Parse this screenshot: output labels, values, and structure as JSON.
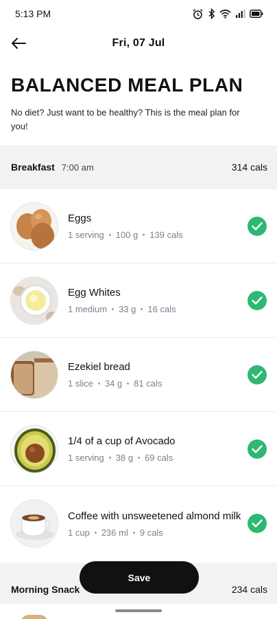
{
  "status_bar": {
    "time": "5:13 PM",
    "icons": [
      "alarm-icon",
      "bluetooth-icon",
      "wifi-icon",
      "signal-icon",
      "battery-icon"
    ]
  },
  "app_bar": {
    "back_icon": "arrow-left-icon",
    "title": "Fri, 07 Jul"
  },
  "plan": {
    "title": "BALANCED MEAL PLAN",
    "description": "No diet? Just want to be healthy?  This is the meal plan for you!"
  },
  "sections": [
    {
      "name": "Breakfast",
      "time": "7:00 am",
      "cals": "314 cals",
      "items": [
        {
          "name": "Eggs",
          "serving": "1 serving",
          "weight": "100 g",
          "cals": "139 cals",
          "done": true
        },
        {
          "name": "Egg Whites",
          "serving": "1 medium",
          "weight": "33 g",
          "cals": "16 cals",
          "done": true
        },
        {
          "name": "Ezekiel bread",
          "serving": "1 slice",
          "weight": "34 g",
          "cals": "81 cals",
          "done": true
        },
        {
          "name": "1/4 of a cup of Avocado",
          "serving": "1 serving",
          "weight": "38 g",
          "cals": "69 cals",
          "done": true
        },
        {
          "name": "Coffee with unsweetened almond milk",
          "serving": "1 cup",
          "weight": "236 ml",
          "cals": "9 cals",
          "done": true
        }
      ]
    },
    {
      "name": "Morning Snack",
      "time": "",
      "cals": "234 cals"
    }
  ],
  "save_button": {
    "label": "Save"
  },
  "colors": {
    "accent_green": "#2eb872",
    "section_bg": "#f1f2f4",
    "meta_gray": "#7a8090"
  }
}
